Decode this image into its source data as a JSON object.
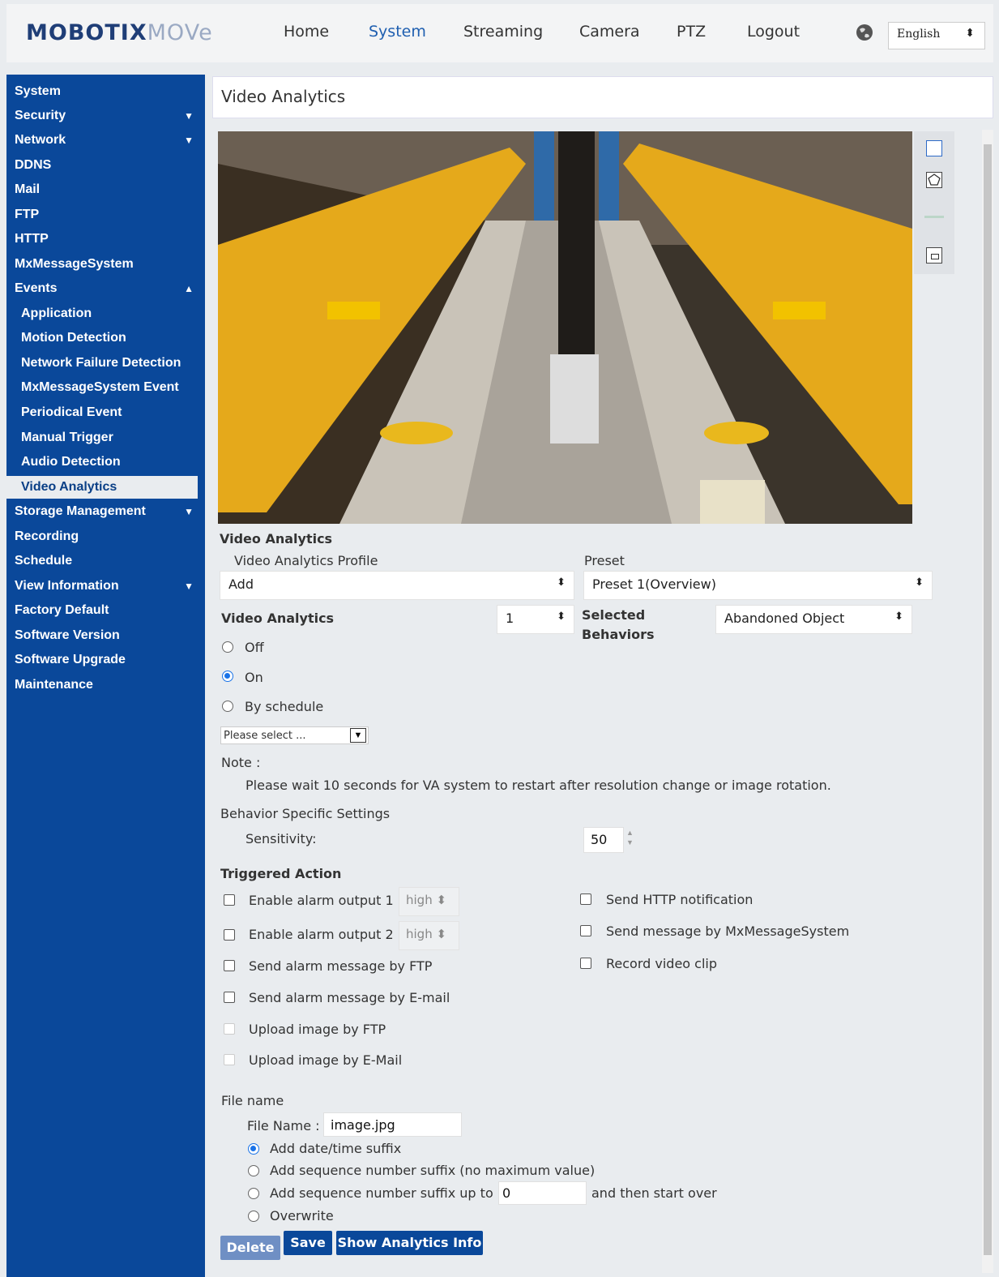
{
  "brand": {
    "part1": "MOBOTIX",
    "part2": "MOVe"
  },
  "nav": [
    "Home",
    "System",
    "Streaming",
    "Camera",
    "PTZ",
    "Logout"
  ],
  "language": "English",
  "sidebar": [
    {
      "label": "System"
    },
    {
      "label": "Security"
    },
    {
      "label": "Network"
    },
    {
      "label": "DDNS"
    },
    {
      "label": "Mail"
    },
    {
      "label": "FTP"
    },
    {
      "label": "HTTP"
    },
    {
      "label": "MxMessageSystem"
    },
    {
      "label": "Events"
    },
    {
      "label": "Application"
    },
    {
      "label": "Motion Detection"
    },
    {
      "label": "Network Failure Detection"
    },
    {
      "label": "MxMessageSystem Event"
    },
    {
      "label": "Periodical Event"
    },
    {
      "label": "Manual Trigger"
    },
    {
      "label": "Audio Detection"
    },
    {
      "label": "Video Analytics"
    },
    {
      "label": "Storage Management"
    },
    {
      "label": "Recording"
    },
    {
      "label": "Schedule"
    },
    {
      "label": "View Information"
    },
    {
      "label": "Factory Default"
    },
    {
      "label": "Software Version"
    },
    {
      "label": "Software Upgrade"
    },
    {
      "label": "Maintenance"
    }
  ],
  "page_title": "Video Analytics",
  "form": {
    "section_title": "Video Analytics",
    "profile_label": "Video Analytics Profile",
    "profile_value": "Add",
    "preset_label": "Preset",
    "preset_value": "Preset 1(Overview)",
    "va_label": "Video Analytics",
    "va_number": "1",
    "behaviors_label_1": "Selected",
    "behaviors_label_2": "Behaviors",
    "behavior_value": "Abandoned Object",
    "off": "Off",
    "on": "On",
    "by_schedule": "By schedule",
    "schedule_placeholder": "Please select ...",
    "note_label": "Note :",
    "note_text": "Please wait 10 seconds for VA system to restart after resolution change or image rotation.",
    "behavior_settings": "Behavior Specific Settings",
    "sensitivity_label": "Sensitivity:",
    "sensitivity_value": "50",
    "triggered_action": "Triggered Action",
    "alarm1": "Enable alarm output 1",
    "alarm2": "Enable alarm output 2",
    "alarm_level": "high",
    "ftp_alarm": "Send alarm message by FTP",
    "email_alarm": "Send alarm message by E-mail",
    "upload_ftp": "Upload image by FTP",
    "upload_email": "Upload image by E-Mail",
    "http_notify": "Send HTTP notification",
    "mxmessage": "Send message by MxMessageSystem",
    "record_clip": "Record video clip",
    "file_name_section": "File name",
    "file_name_label": "File Name :",
    "file_name_value": "image.jpg",
    "opt_datetime": "Add date/time suffix",
    "opt_seq": "Add sequence number suffix (no maximum value)",
    "opt_seq_upto": "Add sequence number suffix up to",
    "seq_value": "0",
    "start_over": "and then start over",
    "overwrite": "Overwrite"
  },
  "buttons": {
    "delete": "Delete",
    "save": "Save",
    "show_info": "Show Analytics Info"
  }
}
